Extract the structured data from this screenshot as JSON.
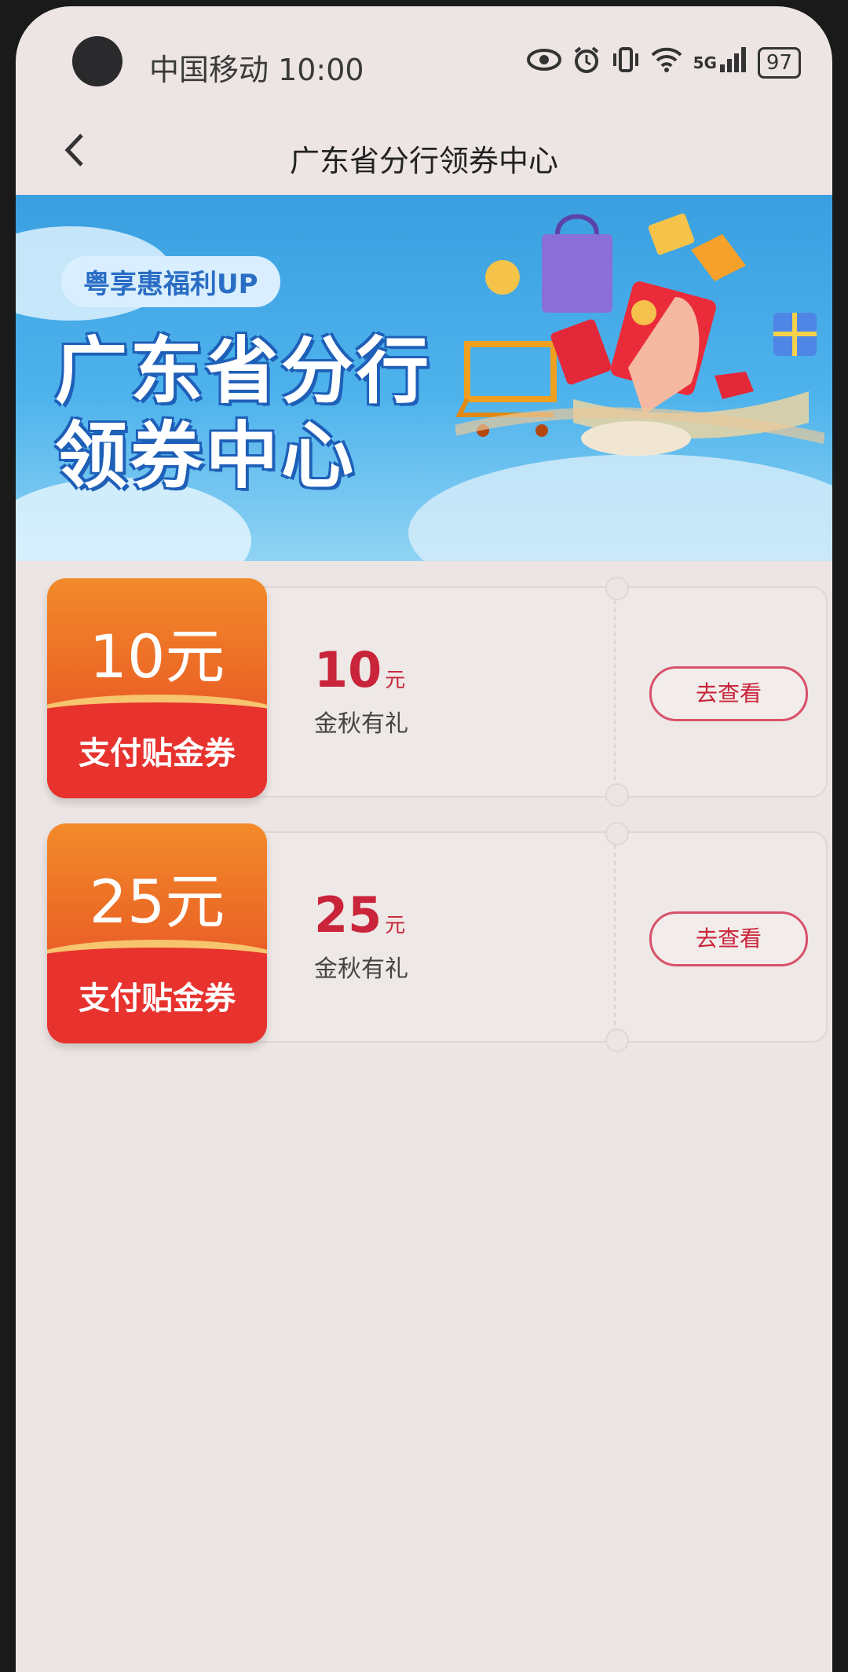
{
  "status_bar": {
    "carrier_time": "中国移动 10:00",
    "signal_label": "5G",
    "battery": "97"
  },
  "nav": {
    "title": "广东省分行领券中心"
  },
  "banner": {
    "tag": "粤享惠福利UP",
    "title_line1": "广东省分行",
    "title_line2": "领券中心"
  },
  "coupons": [
    {
      "badge_amount": "10元",
      "badge_label": "支付贴金券",
      "value": "10",
      "unit": "元",
      "desc": "金秋有礼",
      "button": "去查看"
    },
    {
      "badge_amount": "25元",
      "badge_label": "支付贴金券",
      "value": "25",
      "unit": "元",
      "desc": "金秋有礼",
      "button": "去查看"
    }
  ],
  "icons": [
    "eye-icon",
    "alarm-icon",
    "vibrate-icon",
    "wifi-icon",
    "signal-icon",
    "back-icon"
  ]
}
